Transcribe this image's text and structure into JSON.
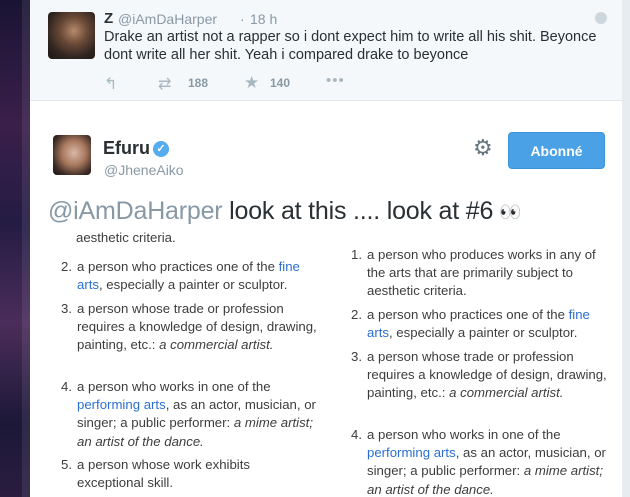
{
  "quoted_tweet": {
    "name": "Z",
    "handle": "@iAmDaHarper",
    "separator": "·",
    "time": "18 h",
    "text": "Drake an artist not a rapper so i dont expect him to write all his shit. Beyonce dont write all her shit. Yeah i compared drake to beyonce",
    "retweet_count": "188",
    "like_count": "140",
    "icons": {
      "reply": "↰",
      "retweet": "⇄",
      "like": "★",
      "more": "•••"
    }
  },
  "tweet": {
    "name": "Efuru",
    "handle": "@JheneAiko",
    "verified_glyph": "✓",
    "gear_glyph": "⚙",
    "follow_label": "Abonné",
    "mention": "@iAmDaHarper",
    "text": " look at this .... look at #6",
    "eyes": "👀"
  },
  "definition_image": {
    "left_fragment": "aesthetic criteria.",
    "left": [
      {
        "num": "2.",
        "pre": "a person who practices one of the ",
        "link": "fine arts",
        "post": ", especially a painter or sculptor.",
        "ital": ""
      },
      {
        "num": "3.",
        "pre": "a person whose trade or profession requires a knowledge of design, drawing, painting, etc.: ",
        "link": "",
        "post": "",
        "ital": "a commercial artist."
      },
      {
        "num": "4.",
        "pre": "a person who works in one of the ",
        "link": "performing arts",
        "post": ", as an actor, musician, or singer; a public performer: ",
        "ital": "a mime artist; an artist of the dance."
      },
      {
        "num": "5.",
        "pre": "a person whose work exhibits exceptional skill.",
        "link": "",
        "post": "",
        "ital": ""
      }
    ],
    "right": [
      {
        "num": "1.",
        "pre": "a person who produces works in any of the arts that are primarily subject to aesthetic criteria.",
        "link": "",
        "post": "",
        "ital": ""
      },
      {
        "num": "2.",
        "pre": "a person who practices one of the ",
        "link": "fine arts",
        "post": ", especially a painter or sculptor.",
        "ital": ""
      },
      {
        "num": "3.",
        "pre": "a person whose trade or profession requires a knowledge of design, drawing, painting, etc.: ",
        "link": "",
        "post": "",
        "ital": "a commercial artist."
      },
      {
        "num": "4.",
        "pre": "a person who works in one of the ",
        "link": "performing arts",
        "post": ", as an actor, musician, or singer; a public performer: ",
        "ital": "a mime artist; an artist of the dance."
      }
    ]
  },
  "colors": {
    "link": "#2a6fd0",
    "follow_button": "#4aa1e6",
    "mention": "#8899a6",
    "verified": "#55acee"
  }
}
